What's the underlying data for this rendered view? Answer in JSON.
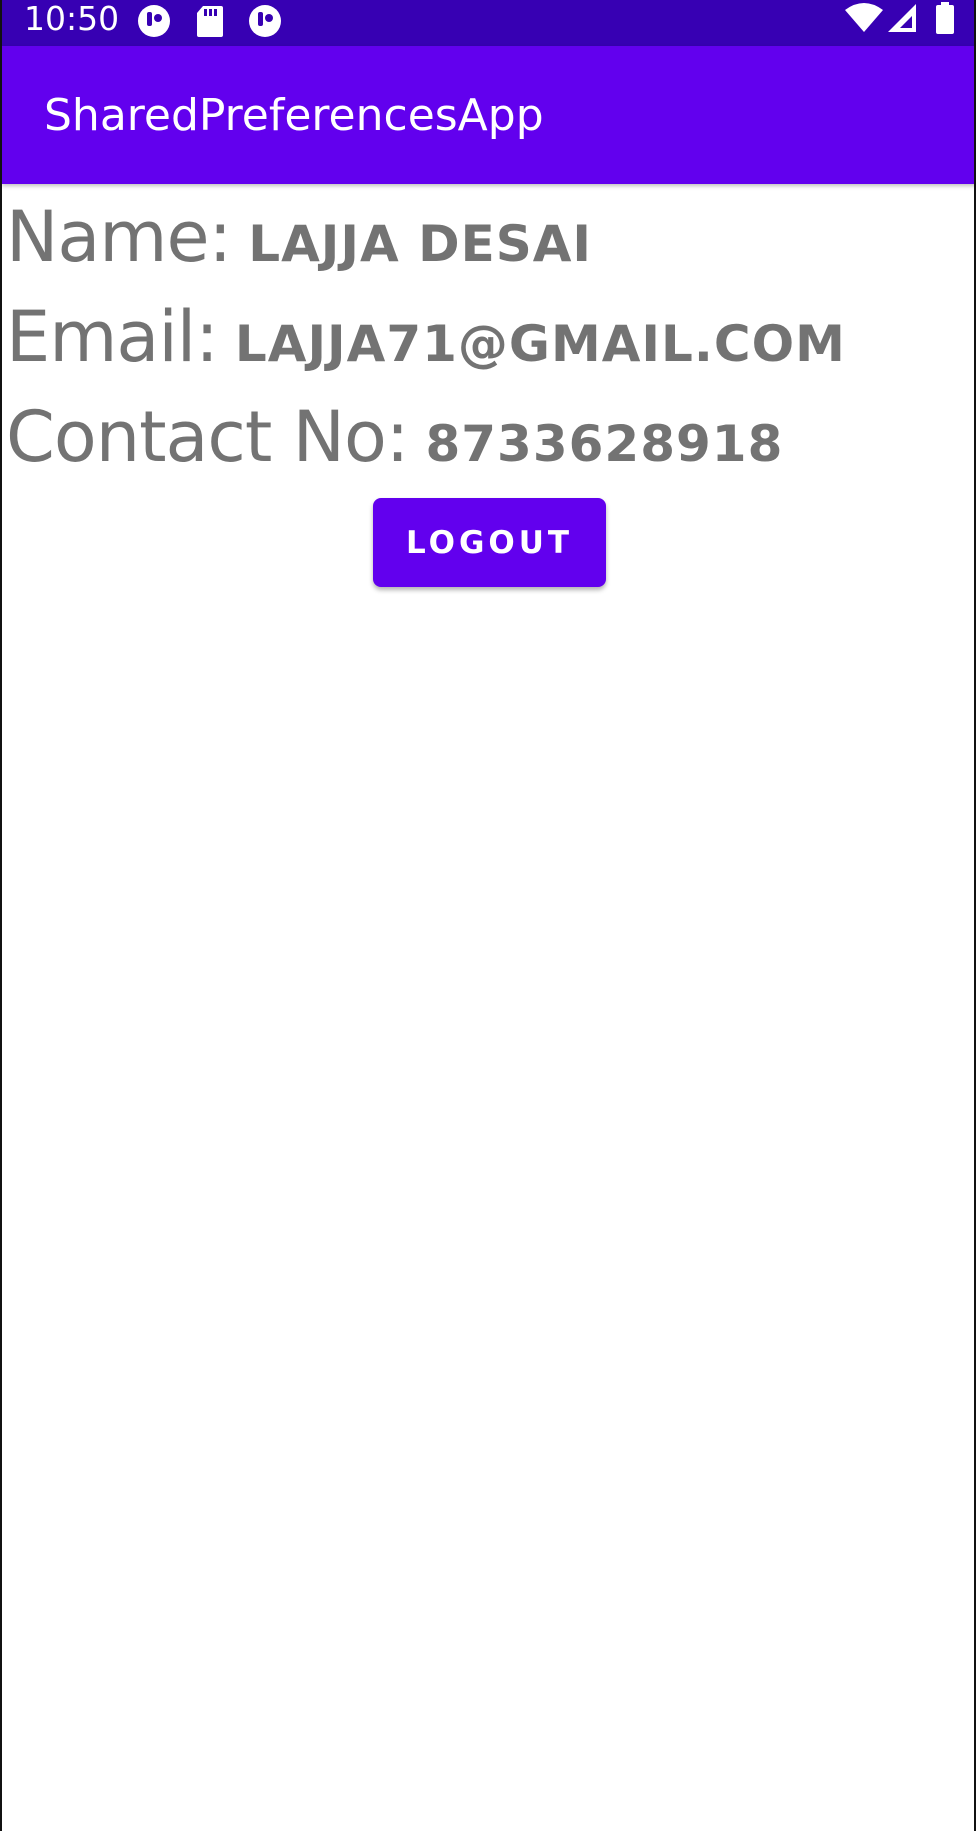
{
  "status_bar": {
    "time": "10:50",
    "left_icons": [
      "notification-icon",
      "sd-card-icon",
      "notification-icon"
    ],
    "right_icons": [
      "wifi-icon",
      "signal-icon",
      "battery-icon"
    ],
    "background_color": "#3700b3"
  },
  "app_bar": {
    "title": "SharedPreferencesApp",
    "background_color": "#6200ee"
  },
  "profile": {
    "name_label": "Name:",
    "name_value": "LAJJA DESAI",
    "email_label": "Email:",
    "email_value": "LAJJA71@GMAIL.COM",
    "contact_label": "Contact No:",
    "contact_value": "8733628918"
  },
  "logout_button": {
    "label": "LOGOUT",
    "background_color": "#6200ee"
  }
}
